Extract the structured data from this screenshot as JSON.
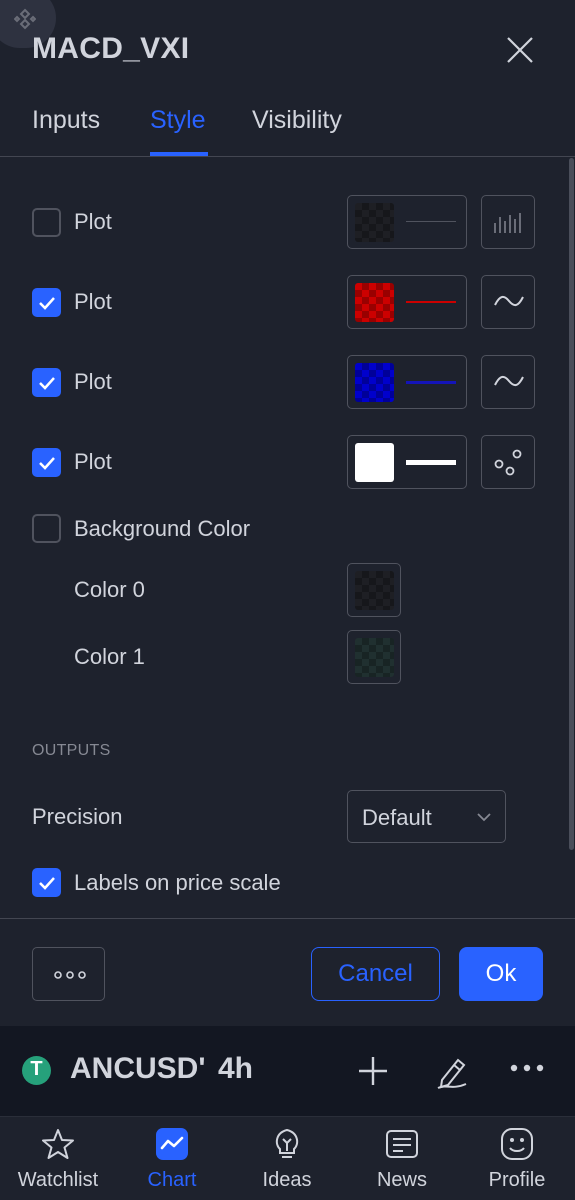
{
  "dialog": {
    "title": "MACD_VXI",
    "tabs": [
      {
        "label": "Inputs",
        "active": false
      },
      {
        "label": "Style",
        "active": true
      },
      {
        "label": "Visibility",
        "active": false
      }
    ]
  },
  "plots": [
    {
      "label": "Plot",
      "checked": false,
      "color": "#1e1f24",
      "line_color": "#50535e",
      "type_icon": "histogram-icon"
    },
    {
      "label": "Plot",
      "checked": true,
      "color": "#cc0000",
      "line_color": "#cc0000",
      "type_icon": "line-icon"
    },
    {
      "label": "Plot",
      "checked": true,
      "color": "#0000cc",
      "line_color": "#1414b8",
      "type_icon": "line-icon"
    },
    {
      "label": "Plot",
      "checked": true,
      "color": "#ffffff",
      "line_color": "#ffffff",
      "type_icon": "circles-icon"
    }
  ],
  "background": {
    "label": "Background Color",
    "checked": false,
    "colors": [
      {
        "label": "Color 0",
        "color": "#1e1f24"
      },
      {
        "label": "Color 1",
        "color": "#203030"
      }
    ]
  },
  "outputs": {
    "header": "OUTPUTS",
    "precision_label": "Precision",
    "precision_value": "Default",
    "labels_on_price_scale": {
      "label": "Labels on price scale",
      "checked": true
    }
  },
  "footer": {
    "cancel_label": "Cancel",
    "ok_label": "Ok"
  },
  "symbol_bar": {
    "coin_glyph": "T",
    "symbol": "ANCUSD'",
    "interval": "4h"
  },
  "bottom_nav": [
    {
      "label": "Watchlist",
      "icon": "star-icon",
      "active": false
    },
    {
      "label": "Chart",
      "icon": "chart-icon",
      "active": true
    },
    {
      "label": "Ideas",
      "icon": "lightbulb-icon",
      "active": false
    },
    {
      "label": "News",
      "icon": "newspaper-icon",
      "active": false
    },
    {
      "label": "Profile",
      "icon": "smiley-icon",
      "active": false
    }
  ],
  "colors": {
    "accent": "#2962ff",
    "background": "#1e222d",
    "text": "#d1d4dc",
    "muted": "#868993",
    "border": "#50535e"
  }
}
